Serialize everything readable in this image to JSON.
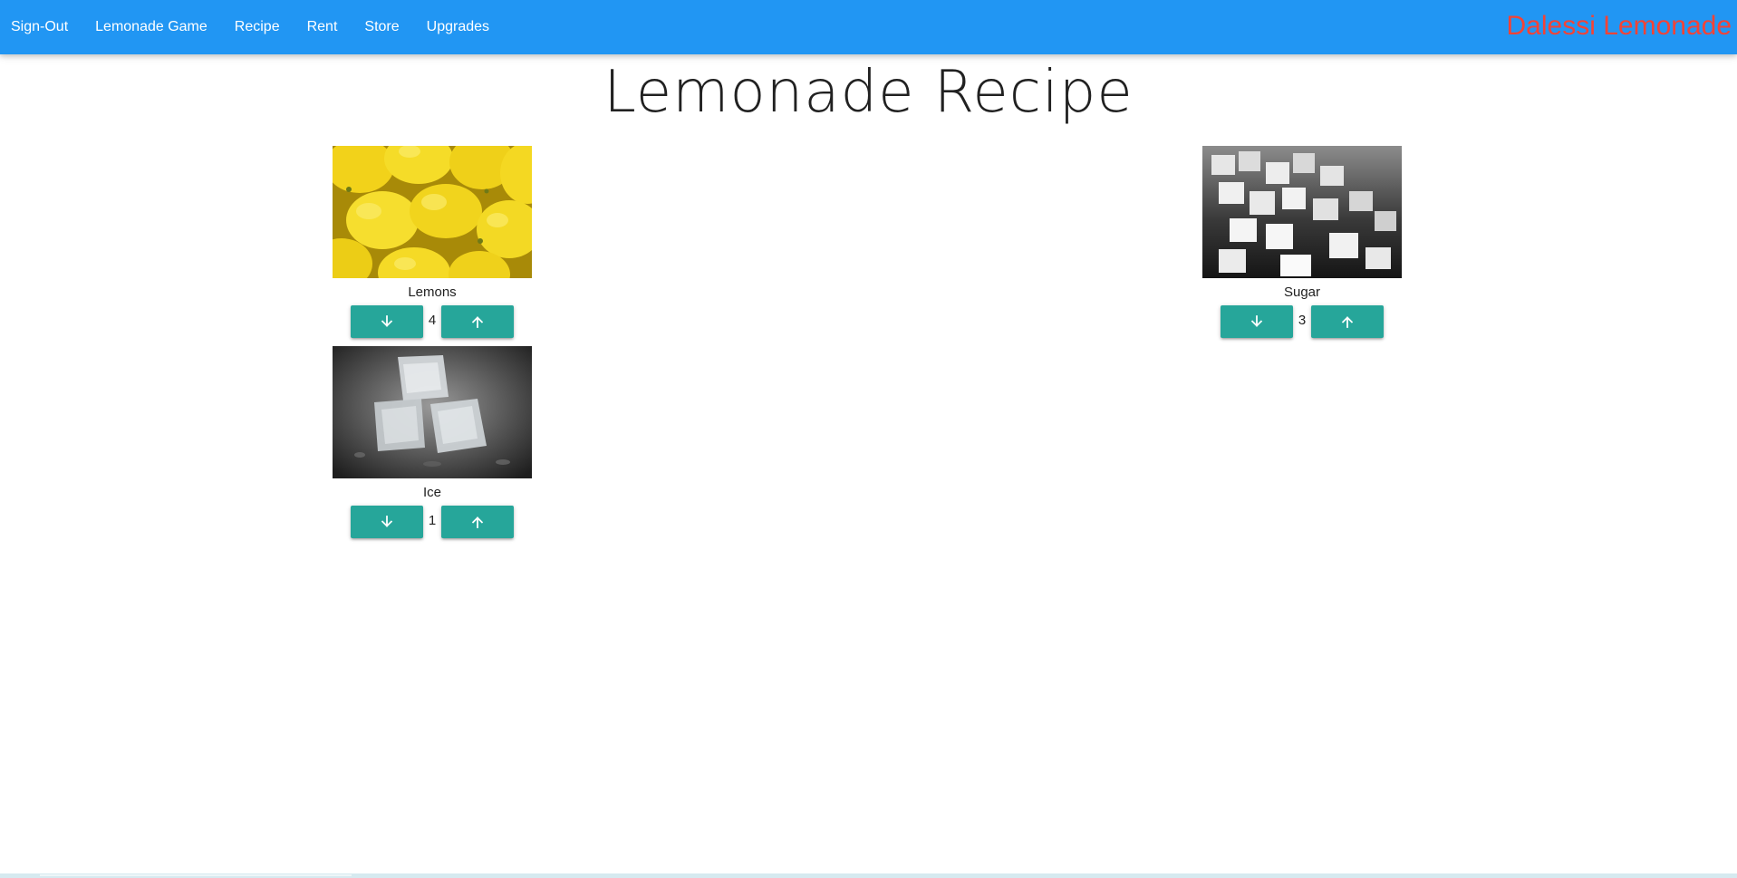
{
  "nav": {
    "links": [
      "Sign-Out",
      "Lemonade Game",
      "Recipe",
      "Rent",
      "Store",
      "Upgrades"
    ],
    "brand": "Dalessi Lemonade"
  },
  "page": {
    "title": "Lemonade Recipe"
  },
  "ingredients": {
    "lemons": {
      "label": "Lemons",
      "quantity": "4",
      "image": "lemons-photo"
    },
    "sugar": {
      "label": "Sugar",
      "quantity": "3",
      "image": "sugar-cubes-photo"
    },
    "ice": {
      "label": "Ice",
      "quantity": "1",
      "image": "ice-cubes-photo"
    }
  },
  "icons": {
    "decrease": "arrow-down-icon",
    "increase": "arrow-up-icon"
  },
  "colors": {
    "navbar": "#2196f3",
    "brand": "#f44336",
    "button": "#26a69a"
  }
}
